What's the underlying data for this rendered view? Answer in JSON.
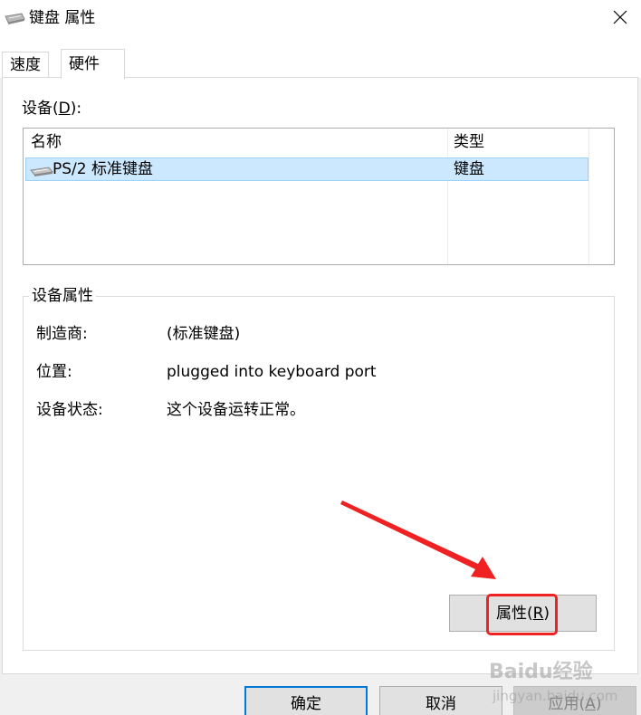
{
  "window": {
    "title": "键盘 属性"
  },
  "tabs": [
    {
      "label": "速度"
    },
    {
      "label": "硬件"
    }
  ],
  "devices_label": {
    "text": "设备(",
    "mnemonic": "D",
    "suffix": "):"
  },
  "device_list": {
    "columns": [
      "名称",
      "类型"
    ],
    "rows": [
      {
        "name": "PS/2 标准键盘",
        "type": "键盘",
        "selected": true
      }
    ]
  },
  "device_properties": {
    "title": "设备属性",
    "fields": [
      {
        "label": "制造商:",
        "value": "(标准键盘)"
      },
      {
        "label": "位置:",
        "value": "plugged into keyboard port"
      },
      {
        "label": "设备状态:",
        "value": "这个设备运转正常。"
      }
    ]
  },
  "buttons": {
    "properties": {
      "text": "属性(",
      "mnemonic": "R",
      "suffix": ")"
    },
    "ok": "确定",
    "cancel": "取消",
    "apply": {
      "text": "应用(",
      "mnemonic": "A",
      "suffix": ")"
    }
  },
  "watermark": {
    "brand": "Baidu经验",
    "url": "jingyan.baidu.com"
  },
  "colors": {
    "selection_bg": "#cce8ff",
    "annotation_red": "#ee2222",
    "default_button_border": "#0078d7"
  },
  "icons": [
    "keyboard-icon",
    "close-icon"
  ]
}
